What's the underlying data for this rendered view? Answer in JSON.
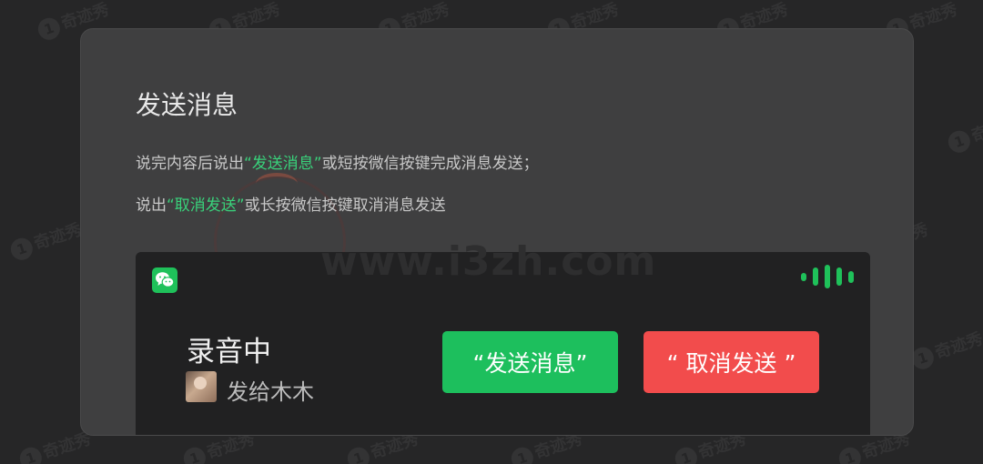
{
  "watermark": {
    "small_text": "奇迹秀",
    "badge": "1",
    "big_text": "www.i3zh.com"
  },
  "card": {
    "title": "发送消息",
    "instruction1": {
      "prefix": "说完内容后说出",
      "highlight": "“发送消息”",
      "suffix": "或短按微信按键完成消息发送；"
    },
    "instruction2": {
      "prefix": "说出",
      "highlight": "“取消发送”",
      "suffix": "或长按微信按键取消消息发送"
    }
  },
  "phone": {
    "app_icon": "wechat-icon",
    "status_title": "录音中",
    "recipient": "发给木木",
    "send_button": "“发送消息”",
    "cancel_button": "“ 取消发送 ”",
    "voice_level_bars": [
      0.35,
      0.75,
      1.0,
      0.75,
      0.5
    ],
    "colors": {
      "accent_green": "#1dbf5d",
      "cancel_red": "#f24c4c",
      "highlight_green": "#39d27b"
    }
  }
}
